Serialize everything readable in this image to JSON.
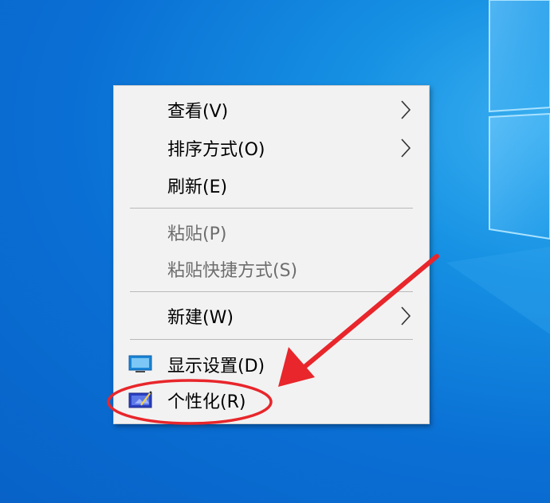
{
  "context_menu": {
    "items": [
      {
        "label": "查看(V)",
        "submenu": true,
        "enabled": true
      },
      {
        "label": "排序方式(O)",
        "submenu": true,
        "enabled": true
      },
      {
        "label": "刷新(E)",
        "submenu": false,
        "enabled": true
      },
      {
        "label": "粘贴(P)",
        "submenu": false,
        "enabled": false
      },
      {
        "label": "粘贴快捷方式(S)",
        "submenu": false,
        "enabled": false
      },
      {
        "label": "新建(W)",
        "submenu": true,
        "enabled": true
      },
      {
        "label": "显示设置(D)",
        "submenu": false,
        "enabled": true,
        "icon": "display-settings-icon"
      },
      {
        "label": "个性化(R)",
        "submenu": false,
        "enabled": true,
        "icon": "personalize-icon",
        "highlighted": true
      }
    ]
  },
  "colors": {
    "desktop_blue": "#0a6fd4",
    "menu_background": "#f2f2f2",
    "annotation_red": "#e8262b",
    "disabled_text": "#6d6d6d"
  }
}
